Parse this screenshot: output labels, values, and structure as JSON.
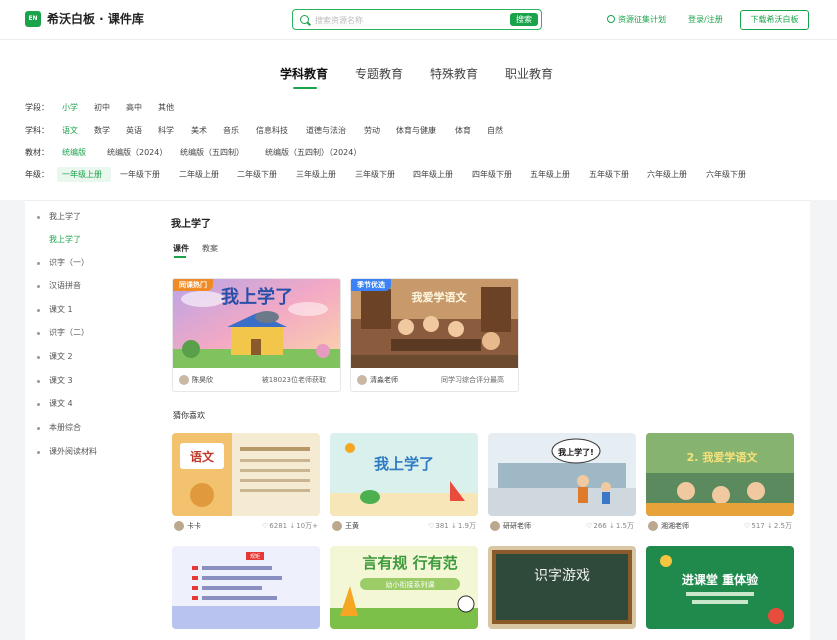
{
  "header": {
    "logo_badge": "EN",
    "logo_text": "希沃白板 · 课件库",
    "search_placeholder": "搜索资源名称",
    "search_button": "搜索",
    "plan_link": "资源征集计划",
    "login_link": "登录/注册",
    "download_button": "下载希沃白板"
  },
  "main_tabs": [
    "学科教育",
    "专题教育",
    "特殊教育",
    "职业教育"
  ],
  "filters": {
    "stage": {
      "label": "学段：",
      "options": [
        "小学",
        "初中",
        "高中",
        "其他"
      ]
    },
    "subject": {
      "label": "学科：",
      "options": [
        "语文",
        "数学",
        "英语",
        "科学",
        "美术",
        "音乐",
        "信息科技",
        "道德与法治",
        "劳动",
        "体育与健康",
        "体育",
        "自然"
      ]
    },
    "edition": {
      "label": "教材：",
      "options": [
        "统编版",
        "统编版（2024）",
        "统编版（五四制）",
        "统编版（五四制）（2024）"
      ]
    },
    "grade": {
      "label": "年级：",
      "options": [
        "一年级上册",
        "一年级下册",
        "二年级上册",
        "二年级下册",
        "三年级上册",
        "三年级下册",
        "四年级上册",
        "四年级下册",
        "五年级上册",
        "五年级下册",
        "六年级上册",
        "六年级下册"
      ]
    }
  },
  "sidebar": {
    "items": [
      "我上学了",
      "我上学了",
      "识字（一）",
      "汉语拼音",
      "课文 1",
      "识字（二）",
      "课文 2",
      "课文 3",
      "课文 4",
      "本册综合",
      "课外阅读材料"
    ]
  },
  "section": {
    "title": "我上学了",
    "tabs": [
      "课件",
      "教案"
    ]
  },
  "featured": [
    {
      "badge": "同课热门",
      "badge_color": "#f08a24",
      "thumb_title": "我上学了",
      "author": "陈昊欣",
      "stat": "被18023位老师获取"
    },
    {
      "badge": "季节优选",
      "badge_color": "#3b82f6",
      "thumb_title": "我爱学语文",
      "author": "清淼老师",
      "stat": "同学习综合评分最高"
    }
  ],
  "guess": {
    "title": "猜你喜欢",
    "cards": [
      {
        "thumb_text": "语文",
        "author": "卡卡",
        "likes": "6281",
        "downloads": "10万+"
      },
      {
        "thumb_text": "我上学了",
        "author": "王黄",
        "likes": "381",
        "downloads": "1.9万"
      },
      {
        "thumb_text": "我上学了!",
        "author": "研研老师",
        "likes": "266",
        "downloads": "1.5万"
      },
      {
        "thumb_text": "2. 我爱学语文",
        "author": "湘湘老师",
        "likes": "517",
        "downloads": "2.5万"
      }
    ],
    "row2": [
      {
        "thumb_text": "",
        "thumb_tag": "规矩"
      },
      {
        "thumb_text": "言有规 行有范",
        "thumb_sub": "幼小衔接系列课"
      },
      {
        "thumb_text": "识字游戏"
      },
      {
        "thumb_text": "进课堂 重体验"
      }
    ]
  },
  "colors": {
    "accent": "#1aa34a"
  }
}
